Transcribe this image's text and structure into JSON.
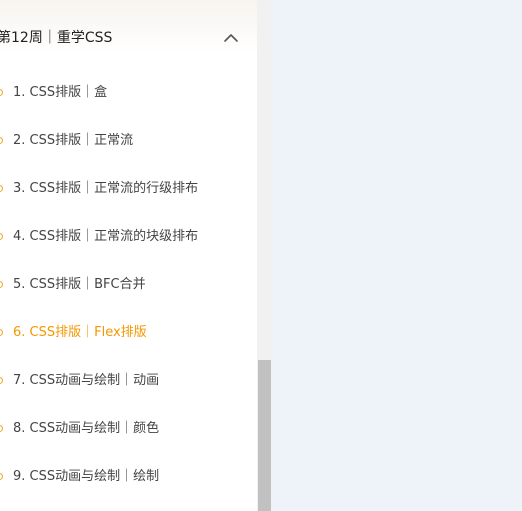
{
  "section": {
    "title": "第12周｜重学CSS",
    "toggle_icon": "chevron-up-icon"
  },
  "lessons": [
    {
      "label": "1. CSS排版｜盒",
      "active": false
    },
    {
      "label": "2. CSS排版｜正常流",
      "active": false
    },
    {
      "label": "3. CSS排版｜正常流的行级排布",
      "active": false
    },
    {
      "label": "4. CSS排版｜正常流的块级排布",
      "active": false
    },
    {
      "label": "5. CSS排版｜BFC合并",
      "active": false
    },
    {
      "label": "6. CSS排版｜Flex排版",
      "active": true
    },
    {
      "label": "7. CSS动画与绘制｜动画",
      "active": false
    },
    {
      "label": "8. CSS动画与绘制｜颜色",
      "active": false
    },
    {
      "label": "9. CSS动画与绘制｜绘制",
      "active": false
    }
  ],
  "colors": {
    "active": "#f39800",
    "dot": "#f5a623",
    "text": "#444444",
    "content_background": "#eef3f9"
  }
}
